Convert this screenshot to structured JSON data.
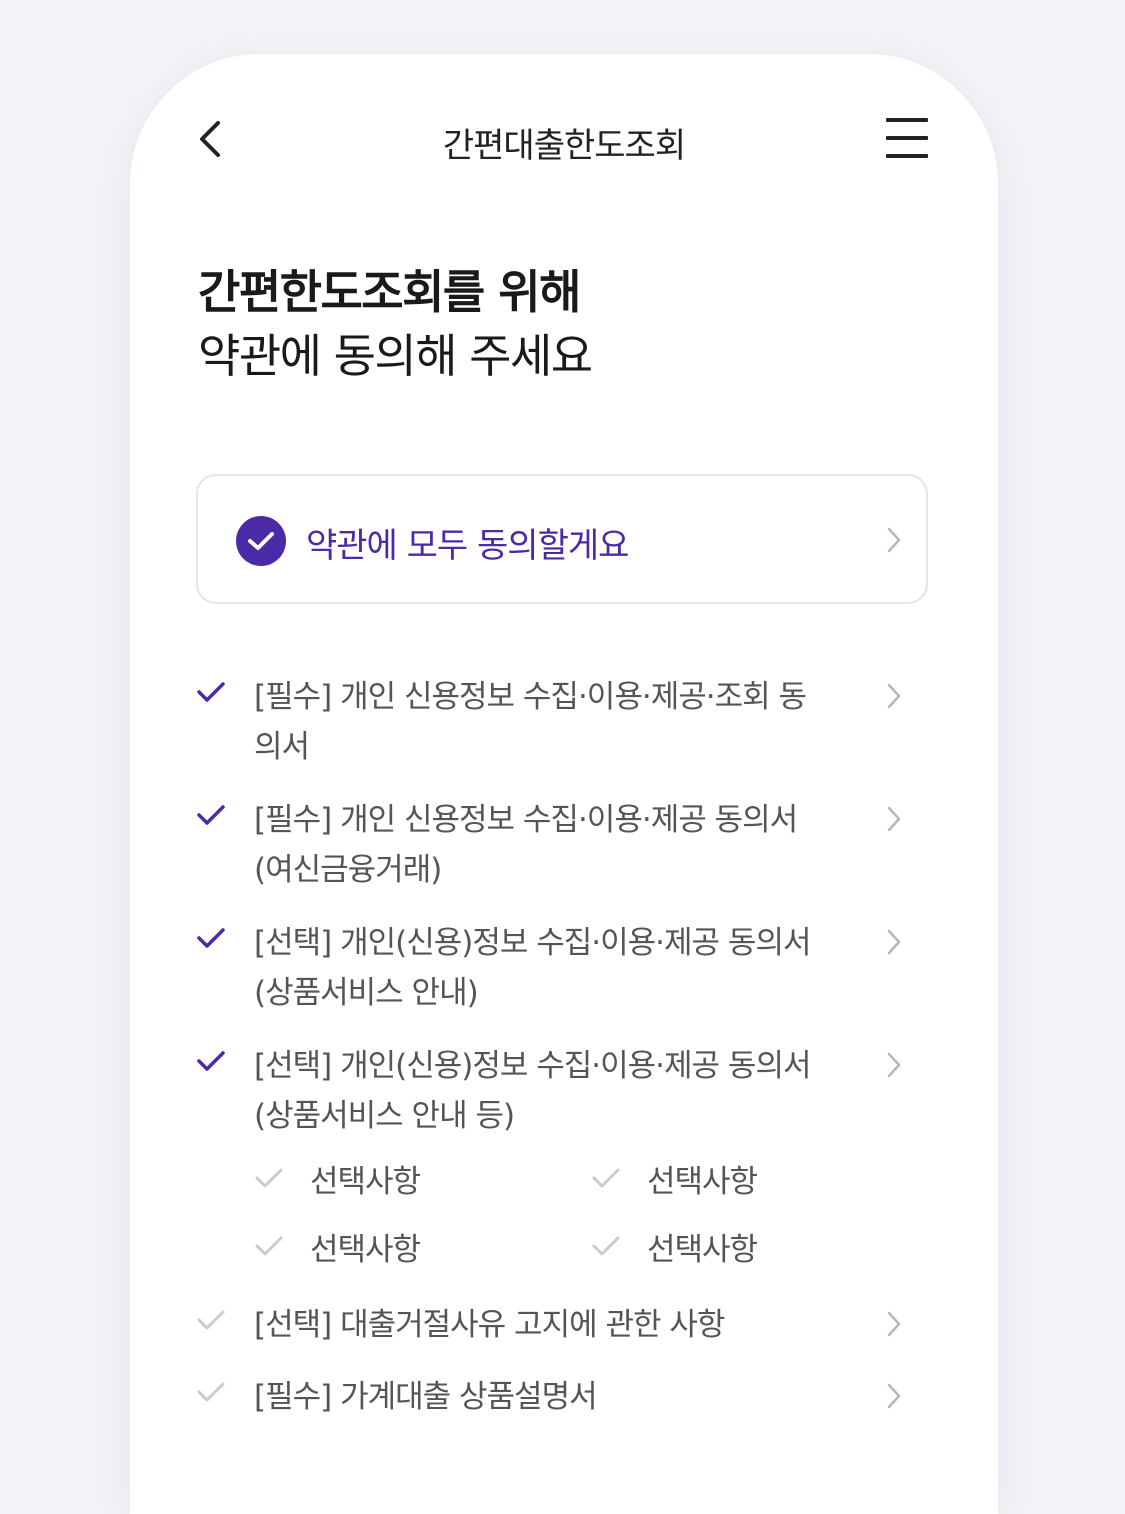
{
  "header": {
    "title": "간편대출한도조회"
  },
  "heading": {
    "line1": "간편한도조회를 위해",
    "line2": "약관에 동의해 주세요"
  },
  "agree_all": {
    "label": "약관에 모두 동의할게요",
    "checked": true
  },
  "terms": [
    {
      "line1": "[필수] 개인 신용정보 수집·이용·제공·조회 동",
      "line2": "의서",
      "checked": true
    },
    {
      "line1": "[필수] 개인 신용정보 수집·이용·제공 동의서",
      "line2": "(여신금융거래)",
      "checked": true
    },
    {
      "line1": "[선택] 개인(신용)정보 수집·이용·제공 동의서",
      "line2": "(상품서비스 안내)",
      "checked": true
    },
    {
      "line1": "[선택] 개인(신용)정보 수집·이용·제공 동의서",
      "line2": "(상품서비스 안내 등)",
      "checked": true
    },
    {
      "line1": "[선택] 대출거절사유 고지에 관한 사항",
      "line2": "",
      "checked": false
    },
    {
      "line1": "[필수] 가계대출 상품설명서",
      "line2": "",
      "checked": false
    }
  ],
  "sub_options": [
    {
      "label": "선택사항",
      "checked": false
    },
    {
      "label": "선택사항",
      "checked": false
    },
    {
      "label": "선택사항",
      "checked": false
    },
    {
      "label": "선택사항",
      "checked": false
    }
  ],
  "colors": {
    "accent": "#4b2aa8",
    "unchecked": "#c9cbd0",
    "chevron": "#b5b7bc",
    "background": "#f1f3f6"
  },
  "icons": {
    "back": "chevron-left-icon",
    "menu": "hamburger-menu-icon",
    "check": "check-icon",
    "chevron": "chevron-right-icon"
  }
}
